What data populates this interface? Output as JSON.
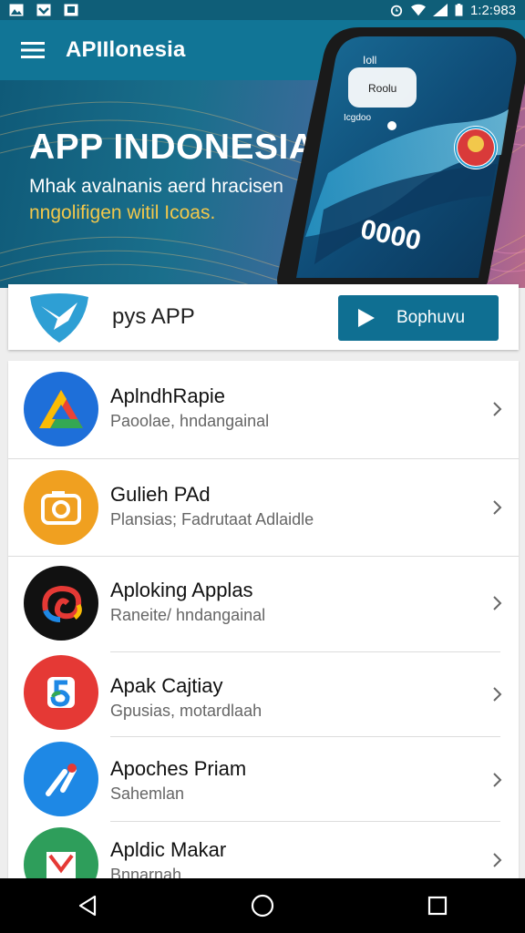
{
  "status_bar": {
    "time": "1:2:983",
    "left_icons": [
      "image-icon",
      "check-icon",
      "photo-icon"
    ],
    "right_icons": [
      "alarm-icon",
      "wifi-icon",
      "signal-icon",
      "battery-icon"
    ]
  },
  "app_bar": {
    "title": "APIIlonesia",
    "menu_icon": "hamburger-icon",
    "search_icon": "search-icon",
    "more_icon": "overflow-icon",
    "color": "#117596"
  },
  "hero": {
    "title": "APP INDONESIA",
    "subtitle_line1": "Mhak avalnanis aerd hracisen",
    "subtitle_line2": "nngolifigen witil Icoas.",
    "accent_color": "#f2c84b",
    "phone_screen": {
      "top_label": "Ioll",
      "app_label": "Roolu",
      "small_text": "Icgdoo",
      "code": "0000"
    }
  },
  "promo": {
    "label": "pys APP",
    "button_label": "Bophuvu",
    "button_color": "#0f6f92"
  },
  "apps": [
    {
      "name": "AplndhRapie",
      "meta": "Paoolae, hndangainal",
      "icon": "drive-triangle-icon",
      "color": "#1e6fd9"
    },
    {
      "name": "Gulieh PAd",
      "meta": "Plansias; Fadrutaat Adlaidle",
      "icon": "camera-icon",
      "color": "#f0a020"
    },
    {
      "name": "Aploking Applas",
      "meta": "Raneite/ hndangainal",
      "icon": "swirl-icon",
      "color": "#111111"
    },
    {
      "name": "Apak Cajtiay",
      "meta": "Gpusias, motardlaah",
      "icon": "spiral-icon",
      "color": "#e53935"
    },
    {
      "name": "Apoches Priam",
      "meta": "Sahemlan",
      "icon": "tools-icon",
      "color": "#1e88e5"
    },
    {
      "name": "Apldic Makar",
      "meta": "Bnnarnah",
      "icon": "flag-icon",
      "color": "#2e9e5b"
    }
  ],
  "nav": {
    "back_icon": "back-icon",
    "home_icon": "home-icon",
    "recents_icon": "recents-icon"
  }
}
